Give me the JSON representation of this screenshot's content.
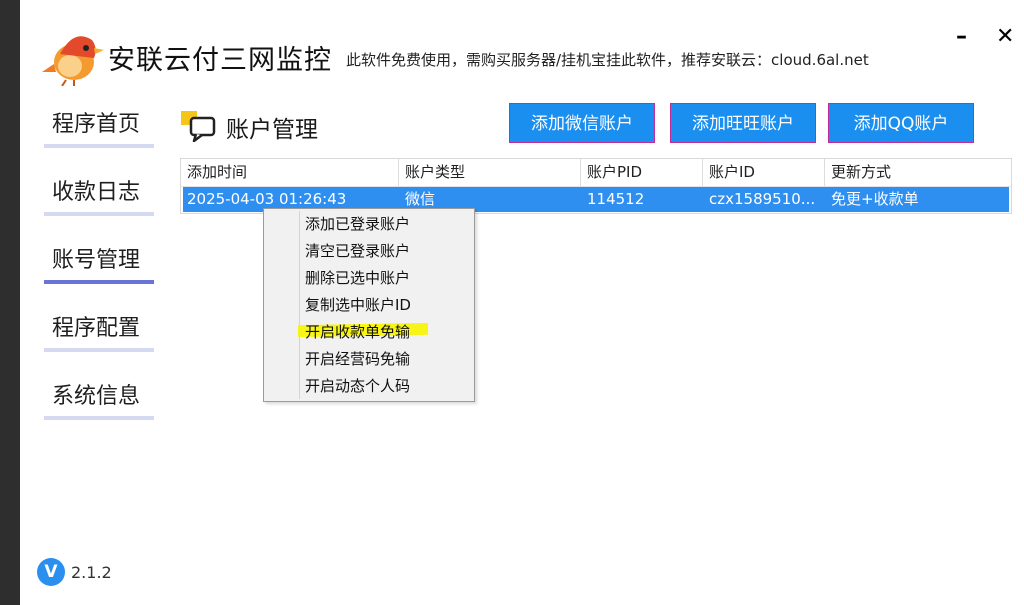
{
  "app": {
    "title": "安联云付三网监控",
    "subtitle": "此软件免费使用，需购买服务器/挂机宝挂此软件，推荐安联云：cloud.6al.net",
    "logo_icon": "bird-logo-icon"
  },
  "window": {
    "minimize": "–",
    "close": "✕"
  },
  "sidebar": {
    "items": [
      {
        "label": "程序首页",
        "active": false
      },
      {
        "label": "收款日志",
        "active": false
      },
      {
        "label": "账号管理",
        "active": true
      },
      {
        "label": "程序配置",
        "active": false
      },
      {
        "label": "系统信息",
        "active": false
      }
    ]
  },
  "section": {
    "title": "账户管理",
    "icon": "chat-bubble-icon"
  },
  "actions": {
    "wechat": "添加微信账户",
    "wangwang": "添加旺旺账户",
    "qq": "添加QQ账户"
  },
  "table": {
    "columns": [
      "添加时间",
      "账户类型",
      "账户PID",
      "账户ID",
      "更新方式"
    ],
    "rows": [
      [
        "2025-04-03 01:26:43",
        "微信",
        "114512",
        "czx1589510...",
        "免更+收款单"
      ]
    ]
  },
  "context_menu": {
    "items": [
      "添加已登录账户",
      "清空已登录账户",
      "删除已选中账户",
      "复制选中账户ID",
      "开启收款单免输",
      "开启经营码免输",
      "开启动态个人码"
    ],
    "highlighted_index": 4
  },
  "version": {
    "badge": "V",
    "number": "2.1.2"
  },
  "colors": {
    "accent": "#1b8ff0",
    "selected_row": "#2e8ff0",
    "nav_active_bar": "#6a73d6",
    "nav_bar": "#d6daf0",
    "highlight": "#f8f400"
  }
}
